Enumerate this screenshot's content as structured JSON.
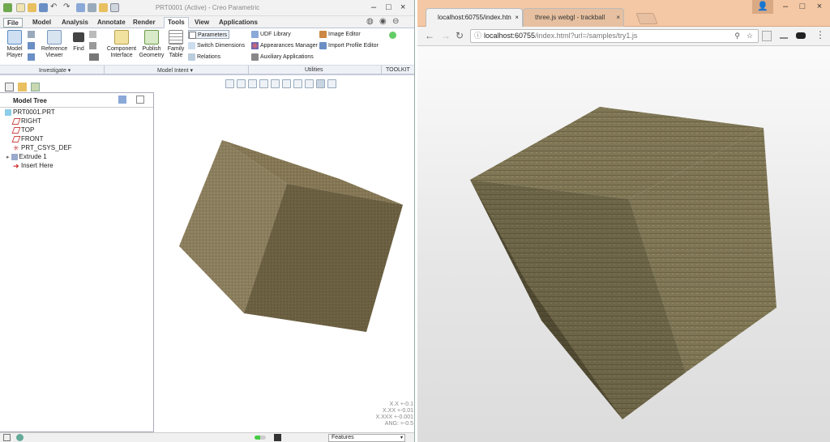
{
  "creo": {
    "title": "PRT0001 (Active) - Creo Parametric",
    "tabs": [
      "File",
      "Model",
      "Analysis",
      "Annotate",
      "Render",
      "Tools",
      "View",
      "Applications"
    ],
    "ribbon": {
      "model_player": "Model Player",
      "reference_viewer": "Reference Viewer",
      "find": "Find",
      "component_interface": "Component Interface",
      "publish_geometry": "Publish Geometry",
      "family_table": "Family Table",
      "parameters": "Parameters",
      "switch_dimensions": "Switch Dimensions",
      "relations": "Relations",
      "udf_library": "UDF Library",
      "appearances_manager": "Appearances Manager",
      "auxiliary_applications": "Auxiliary Applications",
      "image_editor": "Image Editor",
      "import_profile_editor": "Import Profile Editor"
    },
    "groups": [
      "Investigate ▾",
      "Model Intent ▾",
      "Utilities",
      "TOOLKIT"
    ],
    "model_tree": {
      "title": "Model Tree",
      "items": [
        "PRT0001.PRT",
        "RIGHT",
        "TOP",
        "FRONT",
        "PRT_CSYS_DEF",
        "Extrude 1",
        "Insert Here"
      ]
    },
    "accuracy": [
      "X.X +-0.1",
      "X.XX +-0.01",
      "X.XXX +-0.001",
      "ANG: +-0.5"
    ],
    "status_filter": "Features",
    "cube_color": "#8a7c5a"
  },
  "browser": {
    "tab1": "localhost:60755/index.htn",
    "tab2": "three.js webgl - trackball",
    "url_host": "localhost:60755",
    "url_path": "/index.html?url=/samples/try1.js",
    "accent": "#f4c8a4"
  }
}
